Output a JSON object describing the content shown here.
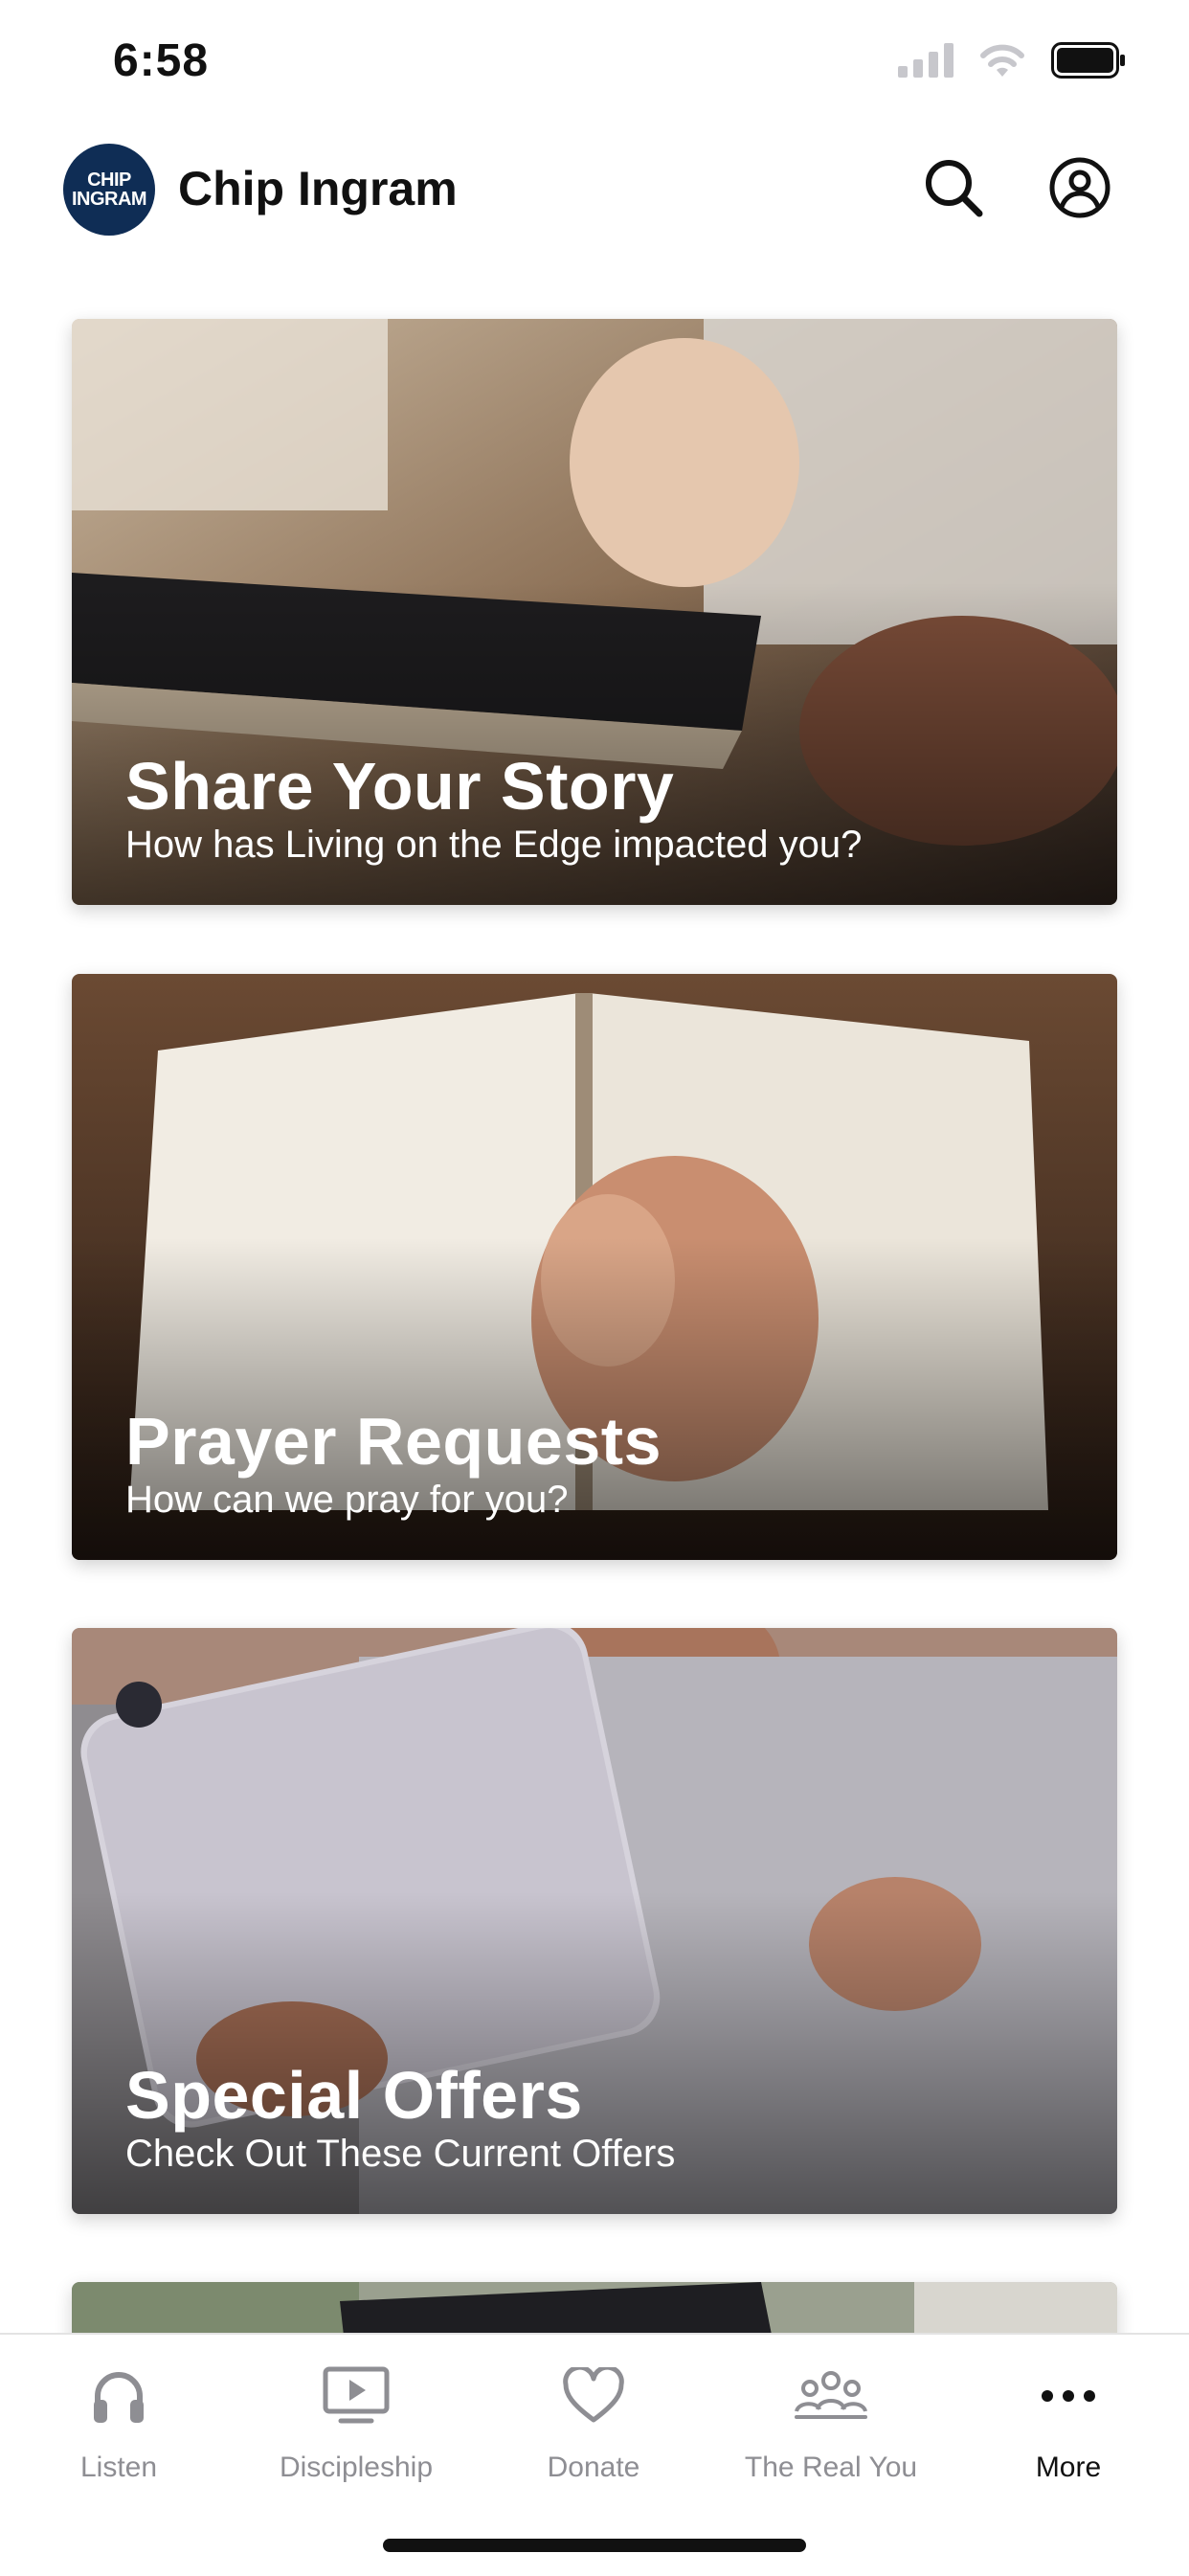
{
  "status_bar": {
    "time": "6:58",
    "icons": [
      "cellular-signal-icon",
      "wifi-icon",
      "battery-icon"
    ]
  },
  "header": {
    "logo_line1": "CHIP",
    "logo_line2": "INGRAM",
    "title": "Chip Ingram",
    "icons": [
      "search-icon",
      "account-circle-icon"
    ],
    "brand_color": "#0f2d55"
  },
  "cards": [
    {
      "title": "Share Your Story",
      "subtitle": "How has Living on the Edge impacted you?"
    },
    {
      "title": "Prayer Requests",
      "subtitle": "How can we pray for you?"
    },
    {
      "title": "Special Offers",
      "subtitle": "Check Out These Current Offers"
    }
  ],
  "tab_bar": {
    "tabs": [
      {
        "label": "Listen",
        "icon": "headphones-icon",
        "active": false
      },
      {
        "label": "Discipleship",
        "icon": "play-screen-icon",
        "active": false
      },
      {
        "label": "Donate",
        "icon": "heart-icon",
        "active": false
      },
      {
        "label": "The Real You",
        "icon": "group-icon",
        "active": false
      },
      {
        "label": "More",
        "icon": "ellipsis-icon",
        "active": true
      }
    ],
    "active_color": "#111111",
    "inactive_color": "#8e8e93"
  }
}
